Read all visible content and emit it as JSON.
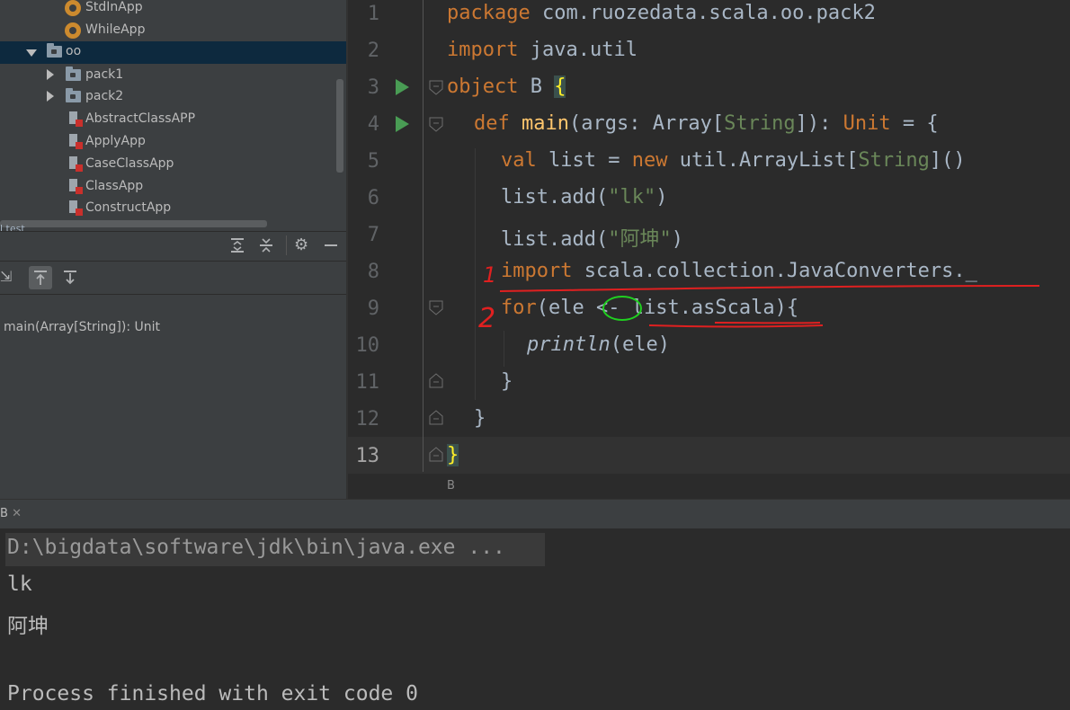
{
  "project_tree": {
    "items": [
      {
        "label": "StdInApp",
        "kind": "object"
      },
      {
        "label": "WhileApp",
        "kind": "object"
      },
      {
        "label": "oo",
        "kind": "package",
        "expanded": true
      },
      {
        "label": "pack1",
        "kind": "package"
      },
      {
        "label": "pack2",
        "kind": "package"
      },
      {
        "label": "AbstractClassAPP",
        "kind": "scala-file"
      },
      {
        "label": "ApplyApp",
        "kind": "scala-file"
      },
      {
        "label": "CaseClassApp",
        "kind": "scala-file"
      },
      {
        "label": "ClassApp",
        "kind": "scala-file"
      },
      {
        "label": "ConstructApp",
        "kind": "scala-file"
      }
    ],
    "cutoff_label": "l test"
  },
  "structure": {
    "item": "main(Array[String]): Unit"
  },
  "editor": {
    "line_numbers": [
      "1",
      "2",
      "3",
      "4",
      "5",
      "6",
      "7",
      "8",
      "9",
      "10",
      "11",
      "12",
      "13"
    ],
    "current_line": "13",
    "breadcrumb": "B",
    "lines": {
      "l1_kw": "package",
      "l1_rest": " com.ruozedata.scala.oo.pack2",
      "l2_kw": "import",
      "l2_rest": " java.util",
      "l3_kw": "object",
      "l3_name": " B ",
      "l3_brace": "{",
      "l4_kw": "def",
      "l4_fn": " main",
      "l4_a": "(args: Array[",
      "l4_ty": "String",
      "l4_b": "]): ",
      "l4_unit": "Unit",
      "l4_c": " = {",
      "l5_kw": "val",
      "l5_a": " list = ",
      "l5_new": "new",
      "l5_b": " util.ArrayList[",
      "l5_ty": "String",
      "l5_c": "]()",
      "l6_a": "list.add(",
      "l6_str": "\"lk\"",
      "l6_b": ")",
      "l7_a": "list.add(",
      "l7_str": "\"阿坤\"",
      "l7_b": ")",
      "l8_kw": "import",
      "l8_rest": " scala.collection.JavaConverters._",
      "l9_kw": "for",
      "l9_rest": "(ele <- list.asScala){",
      "l10_fn": "println",
      "l10_rest": "(ele)",
      "l11": "}",
      "l12": "}",
      "l13": "}"
    }
  },
  "run_panel": {
    "tab_label": "B",
    "output": [
      "D:\\bigdata\\software\\jdk\\bin\\java.exe ...",
      "lk",
      "阿坤",
      "",
      "Process finished with exit code 0"
    ]
  },
  "annotations": {
    "mark1": "1",
    "mark2": "2"
  },
  "colors": {
    "keyword": "#cc7832",
    "function": "#ffc66d",
    "string": "#6a8759",
    "text": "#a9b7c6",
    "annotation_red": "#e02020",
    "annotation_green": "#20d020"
  }
}
